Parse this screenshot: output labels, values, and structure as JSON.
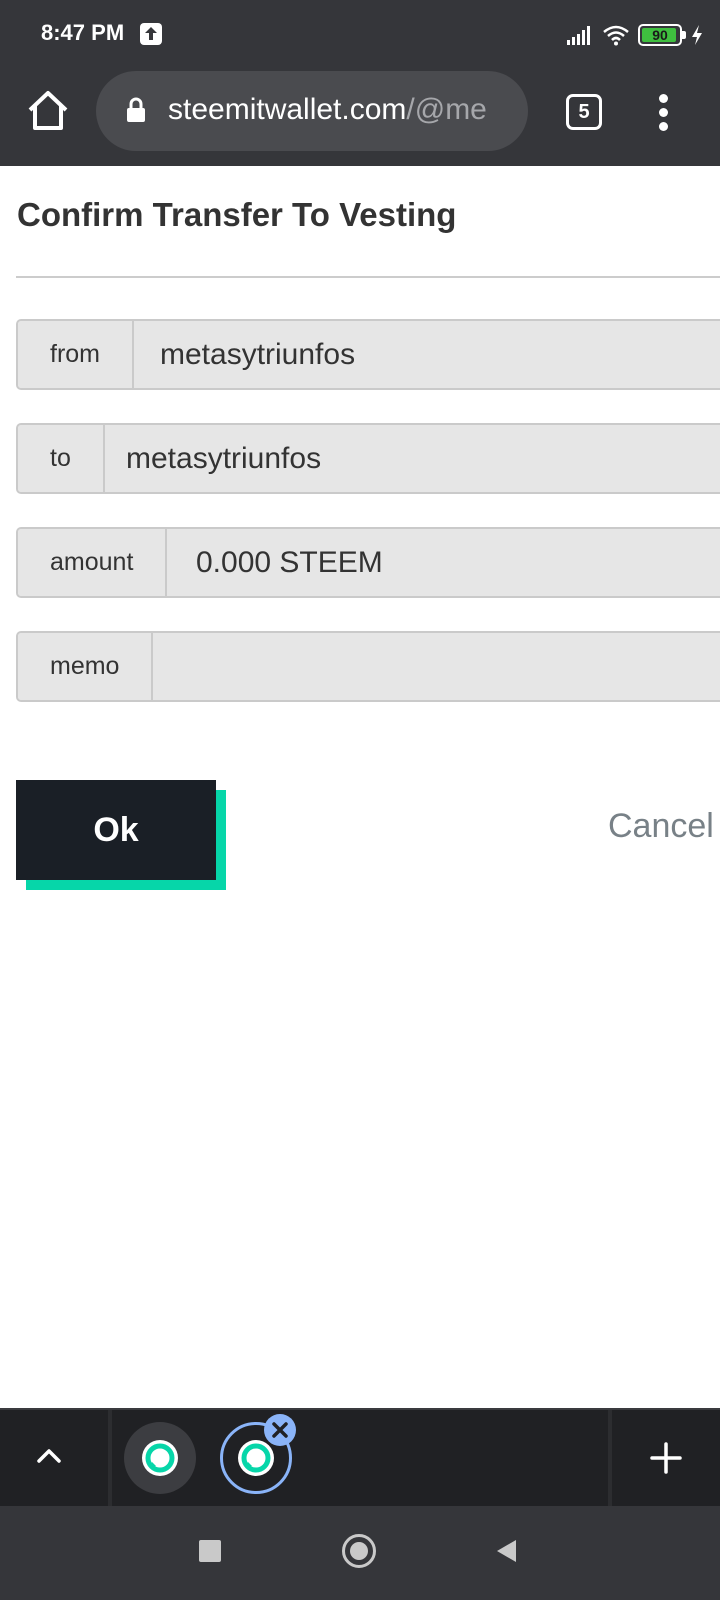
{
  "status_bar": {
    "time": "8:47 PM",
    "battery": "90",
    "icons": [
      "upload-icon",
      "signal-icon",
      "wifi-icon",
      "battery-icon",
      "bolt-icon"
    ]
  },
  "browser": {
    "url_host": "steemitwallet.com",
    "url_path": "/@me",
    "tab_count": "5"
  },
  "dialog": {
    "title": "Confirm Transfer To Vesting",
    "fields": [
      {
        "label": "from",
        "value": "metasytriunfos"
      },
      {
        "label": "to",
        "value": "metasytriunfos"
      },
      {
        "label": "amount",
        "value": "0.000 STEEM"
      },
      {
        "label": "memo",
        "value": ""
      }
    ],
    "ok_label": "Ok",
    "cancel_label": "Cancel"
  },
  "colors": {
    "toolbar_bg": "#35363a",
    "ok_button_bg": "#1a1f26",
    "ok_button_accent": "#06d6a9",
    "field_bg": "#e6e6e6",
    "cancel_text": "#788187"
  }
}
